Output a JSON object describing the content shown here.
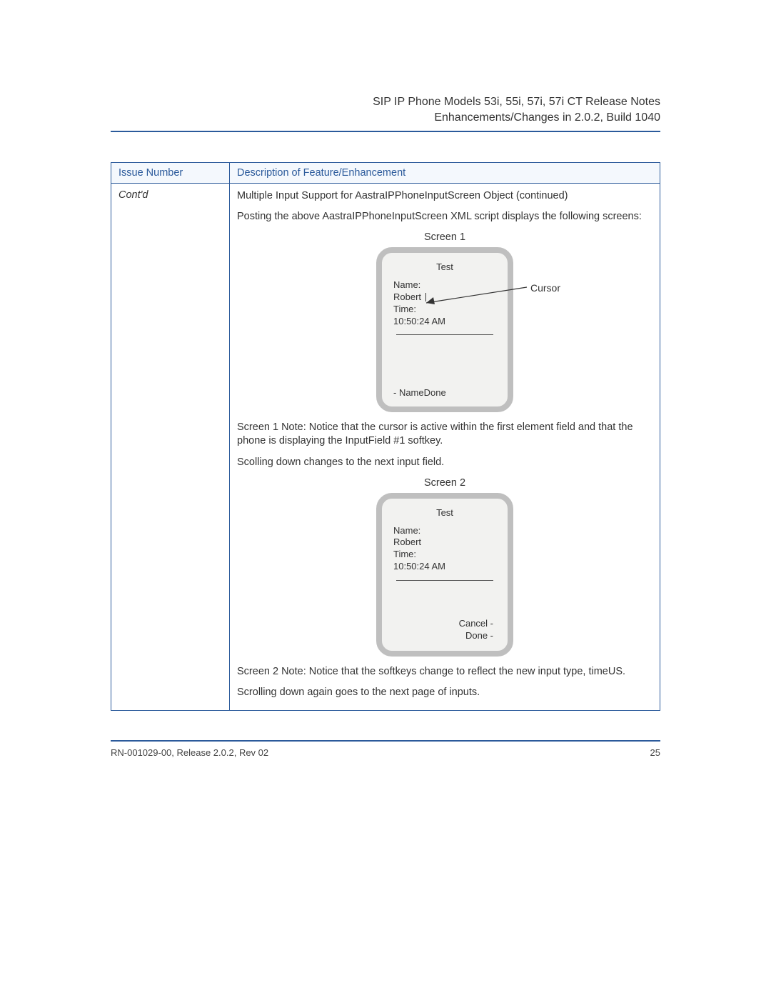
{
  "header": {
    "title_line1": "SIP IP Phone Models 53i, 55i, 57i, 57i CT Release Notes",
    "title_line2": "Enhancements/Changes in 2.0.2, Build 1040"
  },
  "table": {
    "head_col1": "Issue Number",
    "head_col2": "Description of Feature/Enhancement",
    "col1_value": "Cont'd",
    "row_title": "Multiple Input Support for AastraIPPhoneInputScreen Object (continued)",
    "para1": "Posting the above AastraIPPhoneInputScreen XML script displays the following screens:",
    "screen1_label": "Screen 1",
    "screen1_note": "Screen 1 Note: Notice that the cursor is active within the first element field and that the phone is displaying the InputField #1 softkey.",
    "scolling": "Scolling down changes to the next input field.",
    "screen2_label": "Screen 2",
    "screen2_note": "Screen 2 Note: Notice that the softkeys change to reflect the new input type, timeUS.",
    "last": "Scrolling down again goes to the next page of inputs."
  },
  "cursor_label": "Cursor",
  "phone1": {
    "title": "Test",
    "name_label": "Name:",
    "name_value": "Robert ",
    "time_label": "Time:",
    "time_value": "10:50:24 AM",
    "softkey_left": "- NameDone"
  },
  "phone2": {
    "title": "Test",
    "name_label": "Name:",
    "name_value": "Robert",
    "time_label": "Time:",
    "time_value": "10:50:24 AM",
    "softkey_right1": "Cancel -",
    "softkey_right2": "Done -"
  },
  "footer": {
    "left": "RN-001029-00, Release 2.0.2, Rev 02",
    "right": "25"
  }
}
